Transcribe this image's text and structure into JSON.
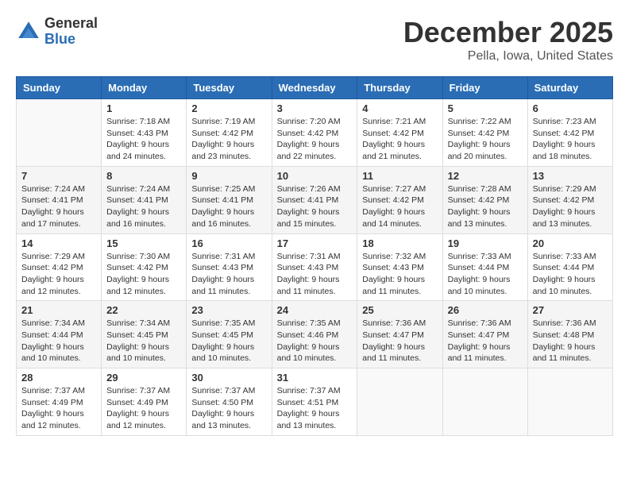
{
  "header": {
    "logo_general": "General",
    "logo_blue": "Blue",
    "month_title": "December 2025",
    "location": "Pella, Iowa, United States"
  },
  "weekdays": [
    "Sunday",
    "Monday",
    "Tuesday",
    "Wednesday",
    "Thursday",
    "Friday",
    "Saturday"
  ],
  "weeks": [
    [
      {
        "day": "",
        "info": ""
      },
      {
        "day": "1",
        "info": "Sunrise: 7:18 AM\nSunset: 4:43 PM\nDaylight: 9 hours\nand 24 minutes."
      },
      {
        "day": "2",
        "info": "Sunrise: 7:19 AM\nSunset: 4:42 PM\nDaylight: 9 hours\nand 23 minutes."
      },
      {
        "day": "3",
        "info": "Sunrise: 7:20 AM\nSunset: 4:42 PM\nDaylight: 9 hours\nand 22 minutes."
      },
      {
        "day": "4",
        "info": "Sunrise: 7:21 AM\nSunset: 4:42 PM\nDaylight: 9 hours\nand 21 minutes."
      },
      {
        "day": "5",
        "info": "Sunrise: 7:22 AM\nSunset: 4:42 PM\nDaylight: 9 hours\nand 20 minutes."
      },
      {
        "day": "6",
        "info": "Sunrise: 7:23 AM\nSunset: 4:42 PM\nDaylight: 9 hours\nand 18 minutes."
      }
    ],
    [
      {
        "day": "7",
        "info": "Sunrise: 7:24 AM\nSunset: 4:41 PM\nDaylight: 9 hours\nand 17 minutes."
      },
      {
        "day": "8",
        "info": "Sunrise: 7:24 AM\nSunset: 4:41 PM\nDaylight: 9 hours\nand 16 minutes."
      },
      {
        "day": "9",
        "info": "Sunrise: 7:25 AM\nSunset: 4:41 PM\nDaylight: 9 hours\nand 16 minutes."
      },
      {
        "day": "10",
        "info": "Sunrise: 7:26 AM\nSunset: 4:41 PM\nDaylight: 9 hours\nand 15 minutes."
      },
      {
        "day": "11",
        "info": "Sunrise: 7:27 AM\nSunset: 4:42 PM\nDaylight: 9 hours\nand 14 minutes."
      },
      {
        "day": "12",
        "info": "Sunrise: 7:28 AM\nSunset: 4:42 PM\nDaylight: 9 hours\nand 13 minutes."
      },
      {
        "day": "13",
        "info": "Sunrise: 7:29 AM\nSunset: 4:42 PM\nDaylight: 9 hours\nand 13 minutes."
      }
    ],
    [
      {
        "day": "14",
        "info": "Sunrise: 7:29 AM\nSunset: 4:42 PM\nDaylight: 9 hours\nand 12 minutes."
      },
      {
        "day": "15",
        "info": "Sunrise: 7:30 AM\nSunset: 4:42 PM\nDaylight: 9 hours\nand 12 minutes."
      },
      {
        "day": "16",
        "info": "Sunrise: 7:31 AM\nSunset: 4:43 PM\nDaylight: 9 hours\nand 11 minutes."
      },
      {
        "day": "17",
        "info": "Sunrise: 7:31 AM\nSunset: 4:43 PM\nDaylight: 9 hours\nand 11 minutes."
      },
      {
        "day": "18",
        "info": "Sunrise: 7:32 AM\nSunset: 4:43 PM\nDaylight: 9 hours\nand 11 minutes."
      },
      {
        "day": "19",
        "info": "Sunrise: 7:33 AM\nSunset: 4:44 PM\nDaylight: 9 hours\nand 10 minutes."
      },
      {
        "day": "20",
        "info": "Sunrise: 7:33 AM\nSunset: 4:44 PM\nDaylight: 9 hours\nand 10 minutes."
      }
    ],
    [
      {
        "day": "21",
        "info": "Sunrise: 7:34 AM\nSunset: 4:44 PM\nDaylight: 9 hours\nand 10 minutes."
      },
      {
        "day": "22",
        "info": "Sunrise: 7:34 AM\nSunset: 4:45 PM\nDaylight: 9 hours\nand 10 minutes."
      },
      {
        "day": "23",
        "info": "Sunrise: 7:35 AM\nSunset: 4:45 PM\nDaylight: 9 hours\nand 10 minutes."
      },
      {
        "day": "24",
        "info": "Sunrise: 7:35 AM\nSunset: 4:46 PM\nDaylight: 9 hours\nand 10 minutes."
      },
      {
        "day": "25",
        "info": "Sunrise: 7:36 AM\nSunset: 4:47 PM\nDaylight: 9 hours\nand 11 minutes."
      },
      {
        "day": "26",
        "info": "Sunrise: 7:36 AM\nSunset: 4:47 PM\nDaylight: 9 hours\nand 11 minutes."
      },
      {
        "day": "27",
        "info": "Sunrise: 7:36 AM\nSunset: 4:48 PM\nDaylight: 9 hours\nand 11 minutes."
      }
    ],
    [
      {
        "day": "28",
        "info": "Sunrise: 7:37 AM\nSunset: 4:49 PM\nDaylight: 9 hours\nand 12 minutes."
      },
      {
        "day": "29",
        "info": "Sunrise: 7:37 AM\nSunset: 4:49 PM\nDaylight: 9 hours\nand 12 minutes."
      },
      {
        "day": "30",
        "info": "Sunrise: 7:37 AM\nSunset: 4:50 PM\nDaylight: 9 hours\nand 13 minutes."
      },
      {
        "day": "31",
        "info": "Sunrise: 7:37 AM\nSunset: 4:51 PM\nDaylight: 9 hours\nand 13 minutes."
      },
      {
        "day": "",
        "info": ""
      },
      {
        "day": "",
        "info": ""
      },
      {
        "day": "",
        "info": ""
      }
    ]
  ]
}
